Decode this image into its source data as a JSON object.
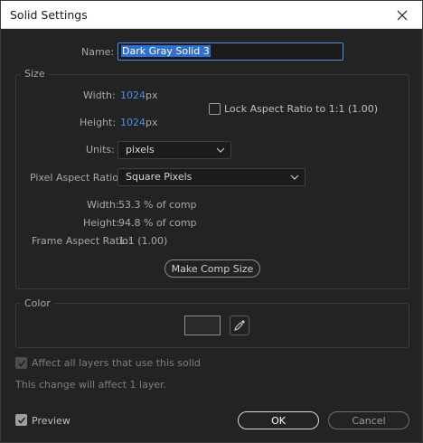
{
  "window": {
    "title": "Solid Settings"
  },
  "name_field": {
    "label": "Name:",
    "value": "Dark Gray Solid 3"
  },
  "size": {
    "group_label": "Size",
    "width_label": "Width:",
    "width_value": "1024",
    "width_unit": "px",
    "height_label": "Height:",
    "height_value": "1024",
    "height_unit": "px",
    "lock_aspect_label": "Lock Aspect Ratio to 1:1 (1.00)",
    "lock_aspect_checked": false,
    "units_label": "Units:",
    "units_value": "pixels",
    "par_label": "Pixel Aspect Ratio:",
    "par_value": "Square Pixels",
    "info": {
      "width_label": "Width:",
      "width_value": "53.3 % of comp",
      "height_label": "Height:",
      "height_value": "94.8 % of comp",
      "far_label": "Frame Aspect Ratio:",
      "far_value": "1:1 (1.00)"
    },
    "make_comp_size_label": "Make Comp Size"
  },
  "color": {
    "group_label": "Color",
    "swatch_color": "#2a2a2a"
  },
  "affect_all": {
    "label": "Affect all layers that use this solid",
    "checked": true,
    "enabled": false,
    "note": "This change will affect 1 layer."
  },
  "preview": {
    "label": "Preview",
    "checked": true
  },
  "buttons": {
    "ok": "OK",
    "cancel": "Cancel"
  }
}
